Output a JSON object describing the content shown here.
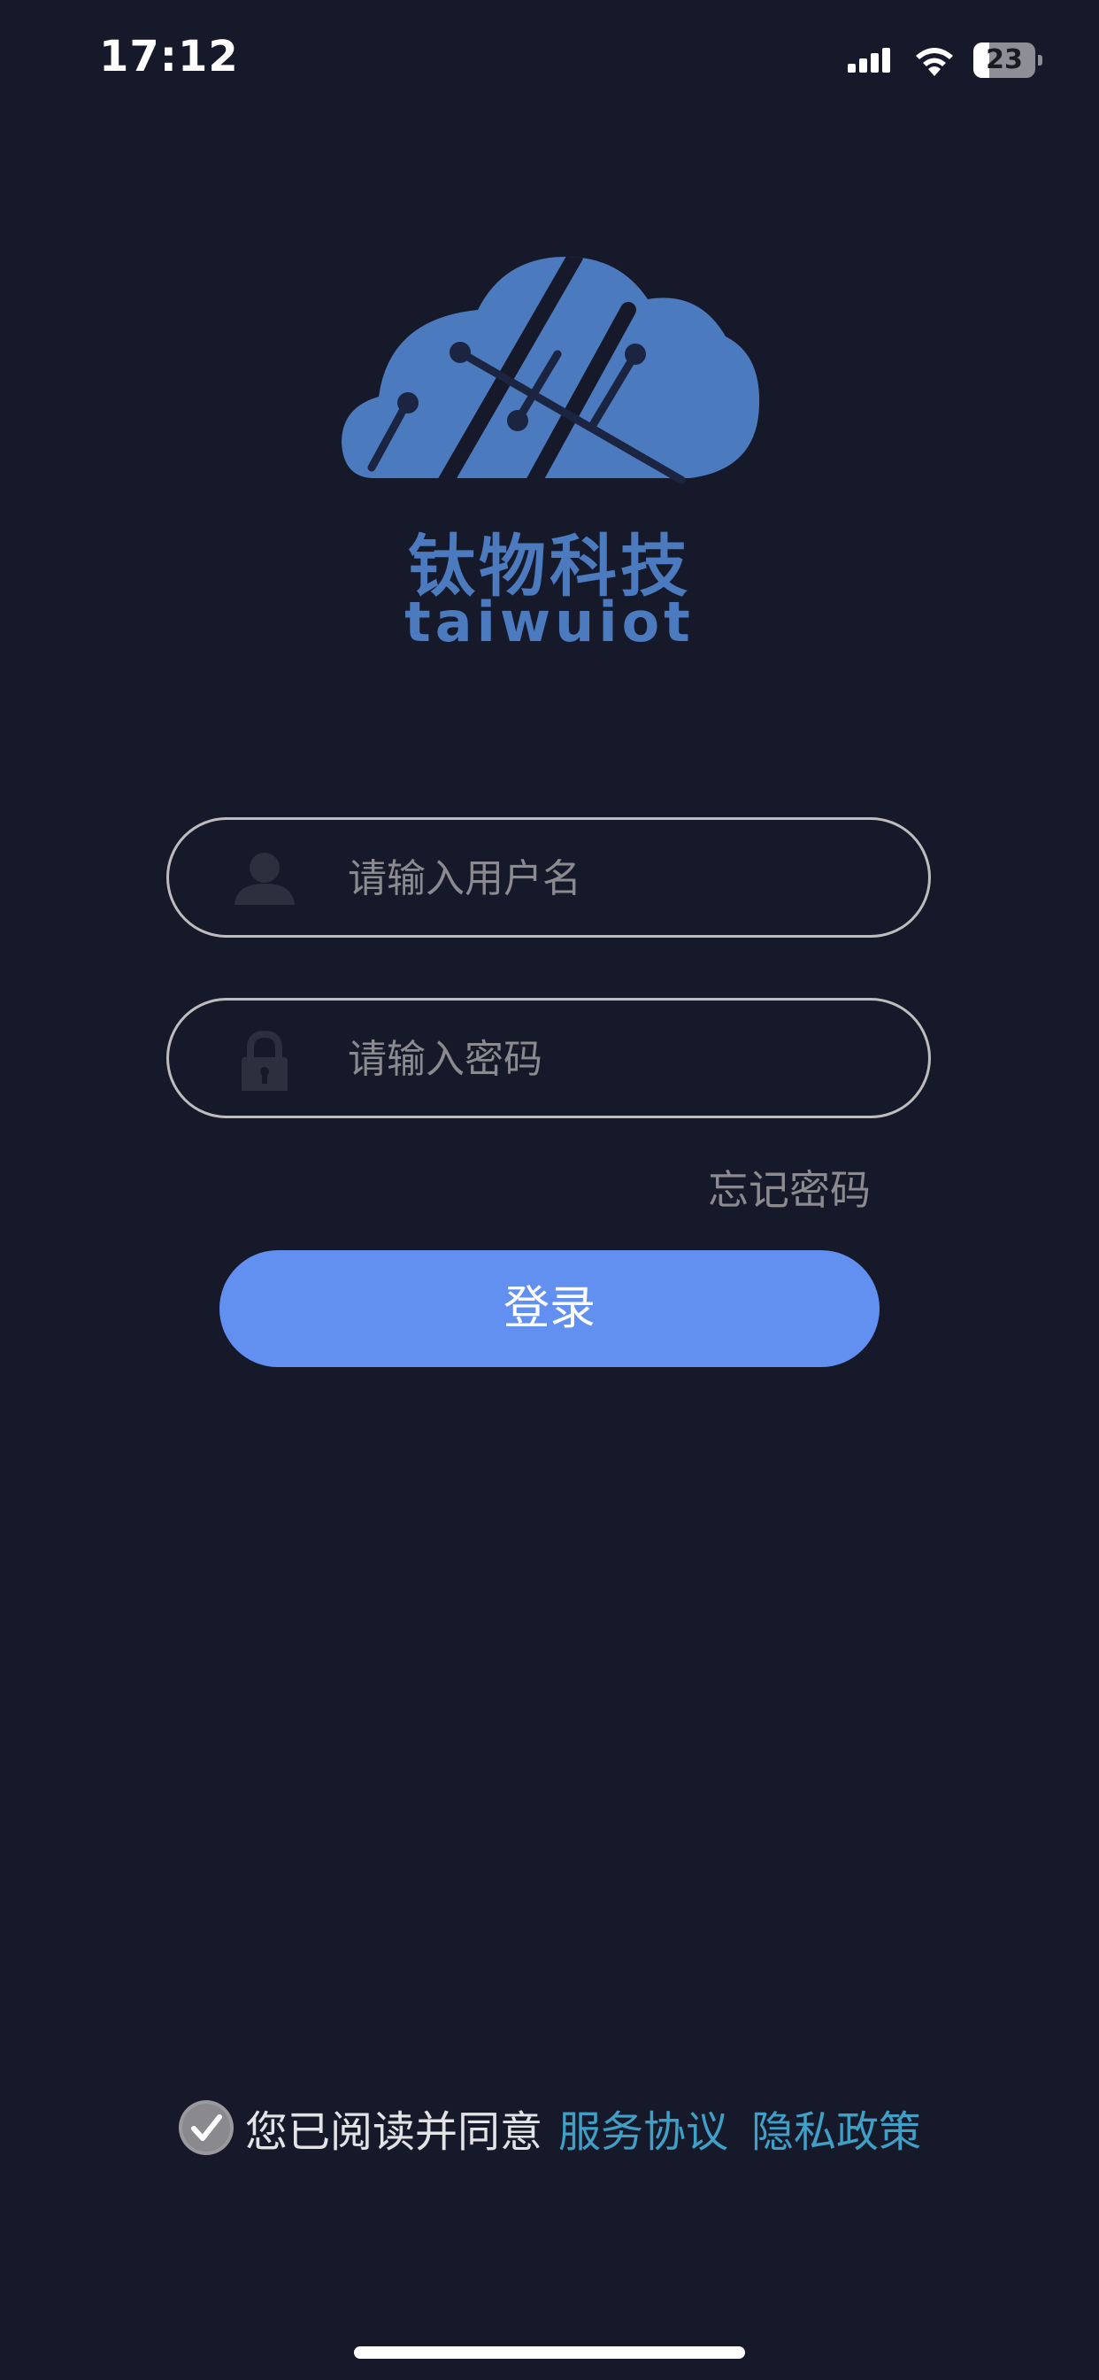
{
  "status_bar": {
    "time": "17:12",
    "battery": "23",
    "icons": [
      "signal-icon",
      "wifi-icon",
      "battery-icon"
    ]
  },
  "brand": {
    "name_cn": "钛物科技",
    "name_en": "taiwuiot",
    "color": "#4c7abf",
    "logo_icon": "cloud-circuit-logo-icon"
  },
  "login_form": {
    "username": {
      "value": "",
      "placeholder": "请输入用户名",
      "icon": "user-icon"
    },
    "password": {
      "value": "",
      "placeholder": "请输入密码",
      "icon": "lock-icon"
    },
    "forgot_password": "忘记密码",
    "login_button": "登录",
    "button_color": "#6190f1"
  },
  "agreement": {
    "checked": true,
    "text": "您已阅读并同意",
    "service_link": "服务协议",
    "privacy_link": "隐私政策",
    "link_color": "#3f9fc7"
  },
  "colors": {
    "background": "#161929"
  }
}
